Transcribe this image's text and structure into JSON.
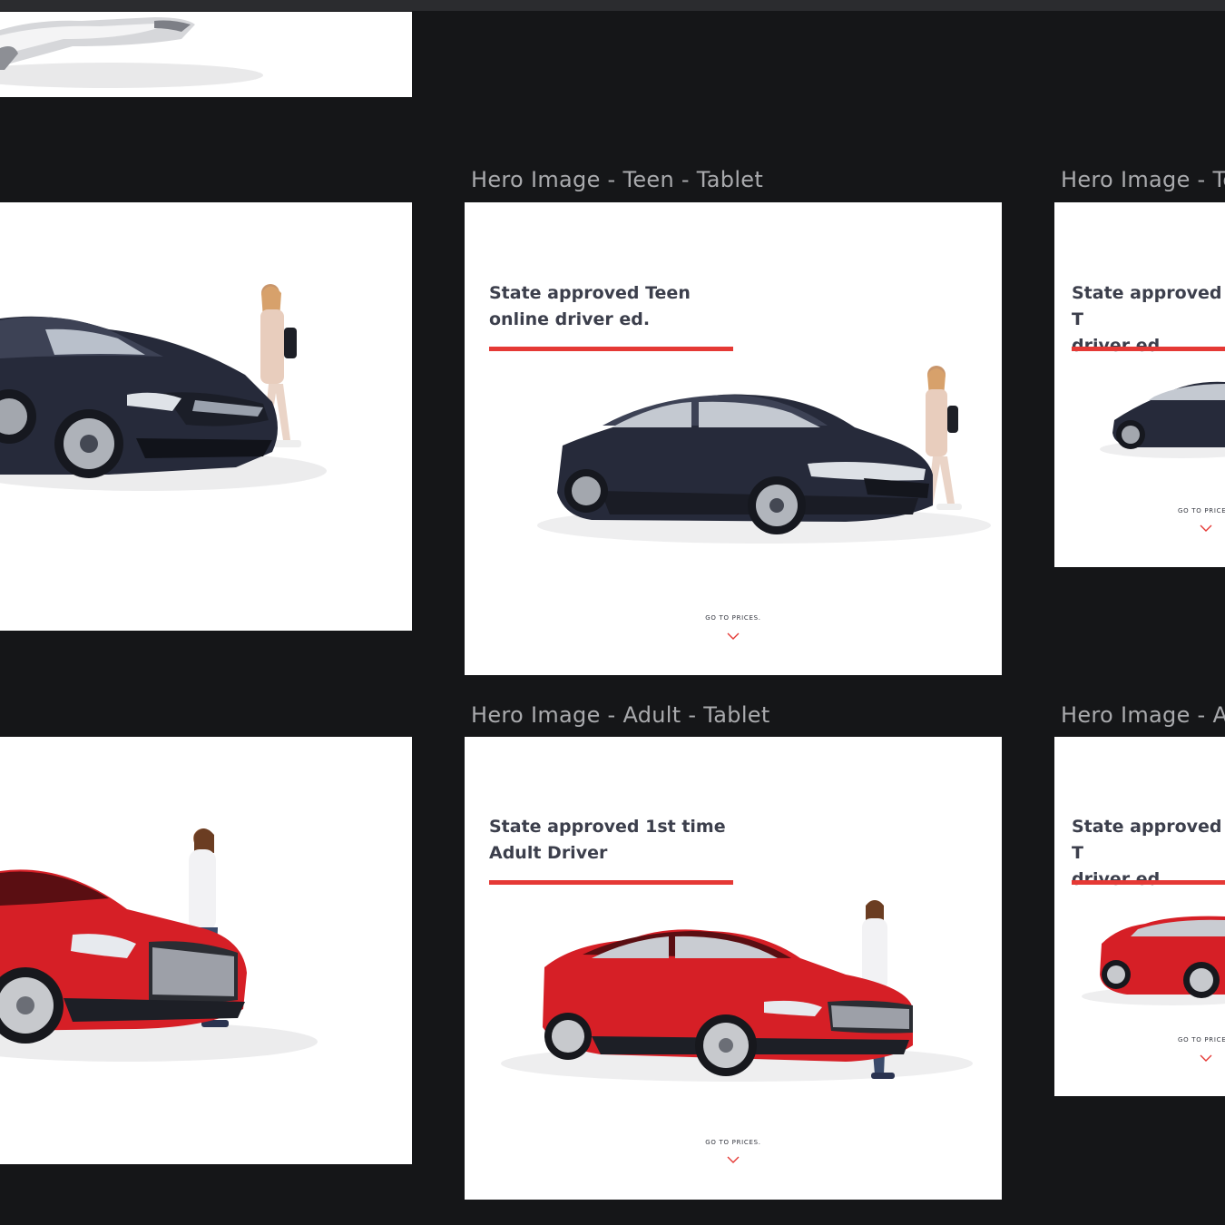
{
  "colors": {
    "canvas": "#151618",
    "artboard": "#ffffff",
    "accent": "#e53935",
    "navy_car": "#262a3a",
    "red_car": "#d61f26",
    "label": "#a9aaad"
  },
  "artboards": {
    "teen_tablet": {
      "label": "Hero Image - Teen - Tablet",
      "headline": "State approved Teen\nonline driver ed.",
      "cta": "GO TO PRICES."
    },
    "teen_right": {
      "label": "Hero Image - Te",
      "headline": "State approved T\ndriver ed.",
      "cta": "GO TO PRICE"
    },
    "adult_tablet": {
      "label": "Hero Image - Adult - Tablet",
      "headline": "State approved 1st time\nAdult Driver",
      "cta": "GO TO PRICES."
    },
    "adult_right": {
      "label": "Hero Image - A",
      "headline": "State approved T\ndriver ed.",
      "cta": "GO TO PRICE"
    }
  },
  "icons": {
    "cta_chevron": "chevron-down-icon"
  }
}
